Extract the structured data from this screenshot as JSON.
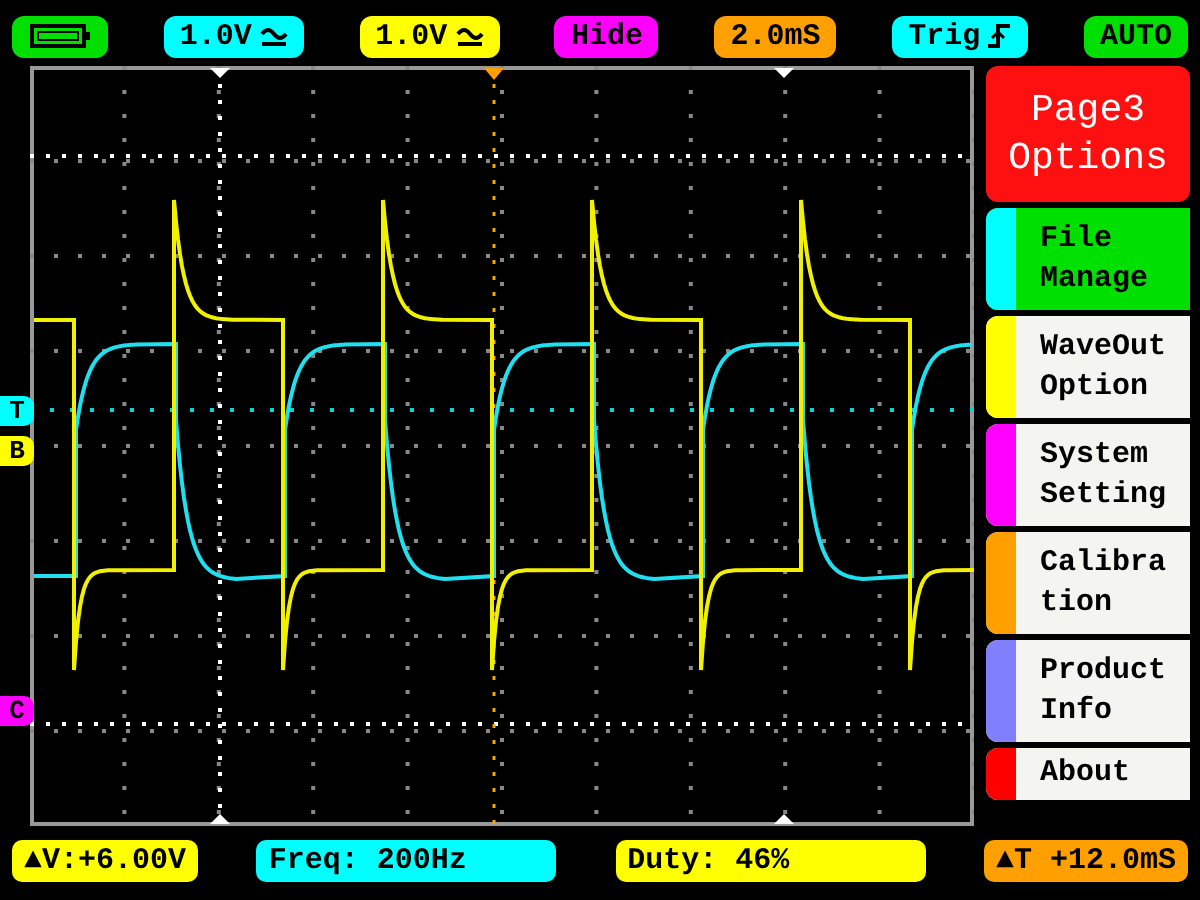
{
  "top_bar": [
    {
      "kind": "battery",
      "color": "#00e000"
    },
    {
      "kind": "coupling",
      "text": "1.0V",
      "color": "#00ffff"
    },
    {
      "kind": "coupling",
      "text": "1.0V",
      "color": "#ffff00"
    },
    {
      "kind": "label",
      "text": "Hide",
      "color": "#ff00ff"
    },
    {
      "kind": "label",
      "text": "2.0mS",
      "color": "#ffa000"
    },
    {
      "kind": "trigger",
      "text": "Trig",
      "color": "#00ffff"
    },
    {
      "kind": "label",
      "text": "AUTO",
      "color": "#00e000"
    }
  ],
  "markers": [
    {
      "label": "T",
      "color": "#00ffff"
    },
    {
      "label": "B",
      "color": "#ffff00"
    },
    {
      "label": "C",
      "color": "#ff00ff"
    }
  ],
  "menu": {
    "title": [
      "Page3",
      "Options"
    ],
    "items": [
      {
        "lines": [
          "File",
          "Manage"
        ],
        "color": "#00ffff",
        "selected": true
      },
      {
        "lines": [
          "WaveOut",
          "Option"
        ],
        "color": "#ffff00",
        "selected": false
      },
      {
        "lines": [
          "System",
          "Setting"
        ],
        "color": "#ff00ff",
        "selected": false
      },
      {
        "lines": [
          "Calibra",
          "tion"
        ],
        "color": "#ffa000",
        "selected": false
      },
      {
        "lines": [
          "Product",
          "Info"
        ],
        "color": "#8080ff",
        "selected": false
      },
      {
        "lines": [
          "About"
        ],
        "color": "#ff0000",
        "selected": false
      }
    ]
  },
  "bottom_bar": [
    {
      "text": "▲V:+6.00V",
      "color": "#ffff00"
    },
    {
      "text": "Freq: 200Hz",
      "color": "#00ffff"
    },
    {
      "text": "Duty: 46%",
      "color": "#ffff00"
    },
    {
      "text": "▲T +12.0mS",
      "color": "#ffa000"
    }
  ]
}
